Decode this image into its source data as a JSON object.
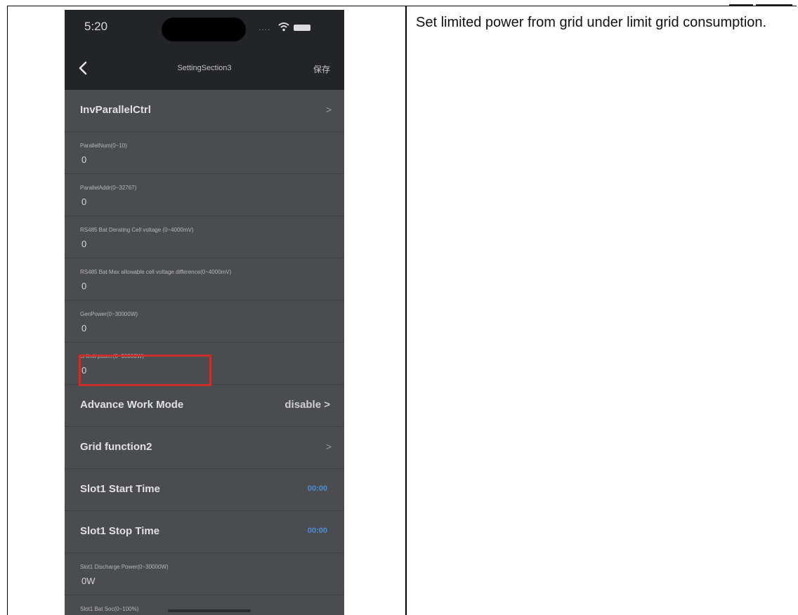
{
  "description": "Set limited power from grid under limit grid consumption.",
  "phone": {
    "status": {
      "time": "5:20",
      "dots": "...."
    },
    "nav": {
      "title": "SettingSection3",
      "save": "保存"
    },
    "rows": [
      {
        "kind": "section",
        "label": "InvParallelCtrl",
        "right": "",
        "chevron": ">"
      },
      {
        "kind": "field",
        "label": "ParallelNum(0~10)",
        "value": "0"
      },
      {
        "kind": "field",
        "label": "ParallelAddr(0~32767)",
        "value": "0"
      },
      {
        "kind": "field",
        "label": "RS485 Bat Derating Cell voltage (0~4000mV)",
        "value": "0"
      },
      {
        "kind": "field",
        "label": "RS485 Bat Max allowable cell voltage difference(0~4000mV)",
        "value": "0"
      },
      {
        "kind": "field",
        "label": "GenPower(0~30000W)",
        "value": "0"
      },
      {
        "kind": "field",
        "label": "ct limit power(0~30000W)",
        "value": "0"
      },
      {
        "kind": "section",
        "label": "Advance Work Mode",
        "right": "disable",
        "chevron": ">"
      },
      {
        "kind": "section",
        "label": "Grid function2",
        "right": "",
        "chevron": ">"
      },
      {
        "kind": "time",
        "label": "Slot1 Start Time",
        "value": "00:00"
      },
      {
        "kind": "time",
        "label": "Slot1 Stop Time",
        "value": "00:00"
      },
      {
        "kind": "field",
        "label": "Slot1 Discharge Power(0~30000W)",
        "value": "0W"
      },
      {
        "kind": "field",
        "label": "Slot1 Bat Soc(0~100%)",
        "value": ""
      }
    ]
  },
  "colors": {
    "highlight": "#c9302c",
    "phone_bg": "#4a4c4f",
    "topbar_bg": "#232427",
    "accent_time": "#4a8fd6"
  }
}
